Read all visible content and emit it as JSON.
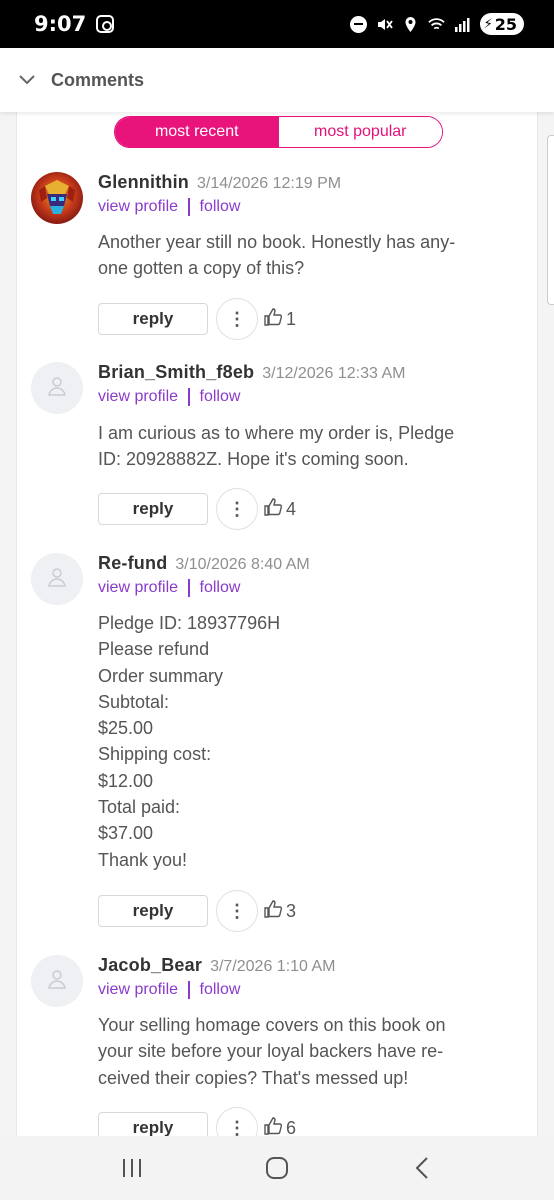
{
  "status_bar": {
    "time": "9:07",
    "battery": "25"
  },
  "header": {
    "title": "Comments"
  },
  "sort": {
    "most_recent": "most recent",
    "most_popular": "most popular",
    "selected": "most recent"
  },
  "colors": {
    "accent_pink": "#e8137b",
    "link_purple": "#8a3bc9"
  },
  "labels": {
    "view_profile": "view profile",
    "follow": "follow",
    "reply": "reply",
    "more": "⋮"
  },
  "comments": [
    {
      "author": "Glennithin",
      "timestamp": "3/14/2026 12:19 PM",
      "avatar": "custom-avatar",
      "body": [
        "Another year still no book. Honestly has any-",
        "one gotten a copy of this?"
      ],
      "likes": "1"
    },
    {
      "author": "Brian_Smith_f8eb",
      "timestamp": "3/12/2026 12:33 AM",
      "avatar": "default-user-icon",
      "body": [
        "I am curious as to where my order is, Pledge",
        "ID: 20928882Z. Hope it's coming soon."
      ],
      "likes": "4"
    },
    {
      "author": "Re-fund",
      "timestamp": "3/10/2026 8:40 AM",
      "avatar": "default-user-icon",
      "body": [
        "Pledge ID: 18937796H",
        "Please refund",
        "Order summary",
        "Subtotal:",
        "$25.00",
        "Shipping cost:",
        "$12.00",
        "Total paid:",
        "$37.00",
        "Thank you!"
      ],
      "likes": "3"
    },
    {
      "author": "Jacob_Bear",
      "timestamp": "3/7/2026 1:10 AM",
      "avatar": "default-user-icon",
      "body": [
        "Your selling homage covers on this book on",
        "your site before your loyal backers have re-",
        "ceived their copies? That's messed up!"
      ],
      "likes": "6"
    }
  ],
  "nav": {
    "recents": "recents-icon",
    "home": "home-icon",
    "back": "back-icon"
  }
}
